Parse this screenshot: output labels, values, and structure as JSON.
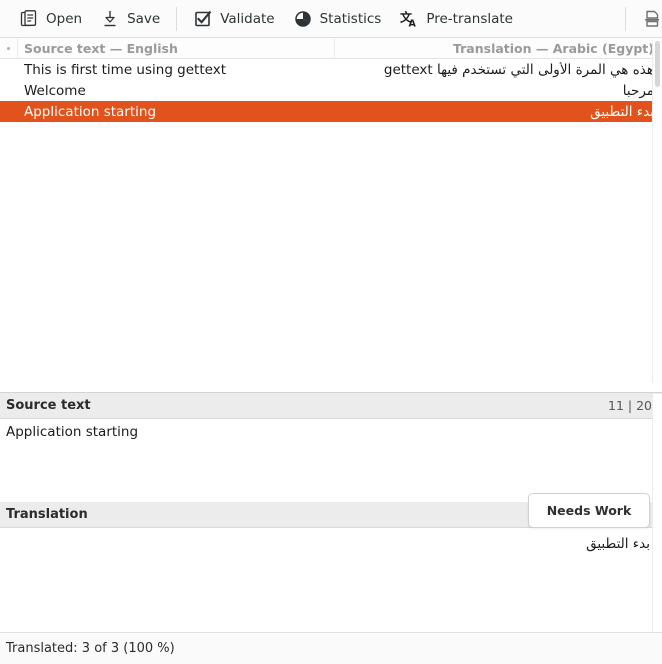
{
  "toolbar": {
    "items": [
      {
        "label": "Open",
        "icon": "open-folder-icon"
      },
      {
        "label": "Save",
        "icon": "save-download-icon"
      },
      {
        "label": "Validate",
        "icon": "checkbox-check-icon"
      },
      {
        "label": "Statistics",
        "icon": "pie-chart-icon"
      },
      {
        "label": "Pre-translate",
        "icon": "translate-icon"
      }
    ],
    "overflow_icon": "document-icon"
  },
  "list": {
    "header": {
      "flag_marker": "·",
      "source_column": "Source text — English",
      "target_column": "Translation — Arabic (Egypt)"
    },
    "rows": [
      {
        "source": "This is first time using gettext",
        "target": "هذه هي المرة الأولى التي تستخدم فيها gettext",
        "selected": false
      },
      {
        "source": "Welcome",
        "target": "مرحبا",
        "selected": false
      },
      {
        "source": "Application starting",
        "target": "بدء التطبيق",
        "selected": true
      }
    ]
  },
  "source_panel": {
    "title": "Source text",
    "counter": "11 | 20",
    "text": "Application starting"
  },
  "translation_panel": {
    "title": "Translation",
    "needs_work_label": "Needs Work",
    "text": "بدء التطبيق"
  },
  "statusbar": {
    "text": "Translated: 3 of 3 (100 %)"
  },
  "colors": {
    "selection_orange": "#e2521c",
    "toolbar_bg": "#fbfbfb",
    "panel_header_bg": "#ececec",
    "header_text": "#9a9a9a"
  }
}
